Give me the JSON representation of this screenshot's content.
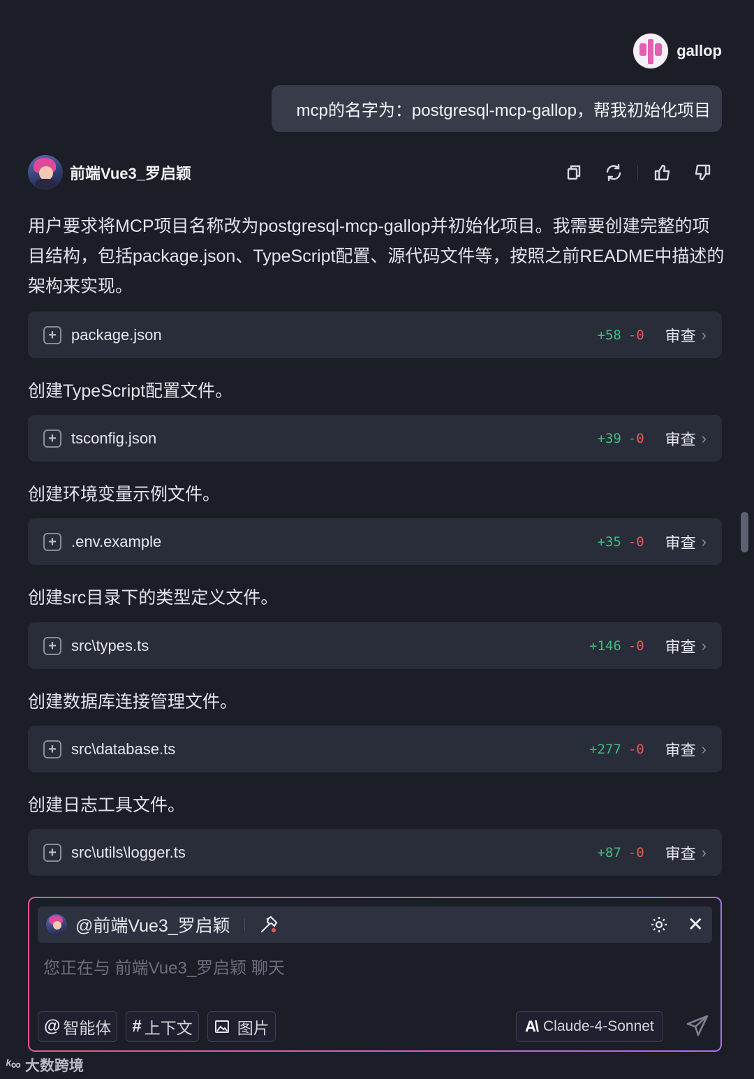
{
  "user": {
    "name": "gallop",
    "message": "mcp的名字为：postgresql-mcp-gallop，帮我初始化项目"
  },
  "assistant": {
    "name": "前端Vue3_罗启颖",
    "intro": "用户要求将MCP项目名称改为postgresql-mcp-gallop并初始化项目。我需要创建完整的项目结构，包括package.json、TypeScript配置、源代码文件等，按照之前README中描述的架构来实现。",
    "actions": [
      "copy-icon",
      "refresh-icon",
      "thumbs-up-icon",
      "thumbs-down-icon"
    ]
  },
  "files": [
    {
      "name": "package.json",
      "added": "+58",
      "removed": "-0",
      "review": "审查"
    },
    {
      "name": "tsconfig.json",
      "added": "+39",
      "removed": "-0",
      "review": "审查"
    },
    {
      "name": ".env.example",
      "added": "+35",
      "removed": "-0",
      "review": "审查"
    },
    {
      "name": "src\\types.ts",
      "added": "+146",
      "removed": "-0",
      "review": "审查"
    },
    {
      "name": "src\\database.ts",
      "added": "+277",
      "removed": "-0",
      "review": "审查"
    },
    {
      "name": "src\\utils\\logger.ts",
      "added": "+87",
      "removed": "-0",
      "review": "审查"
    }
  ],
  "steps": [
    "创建TypeScript配置文件。",
    "创建环境变量示例文件。",
    "创建src目录下的类型定义文件。",
    "创建数据库连接管理文件。",
    "创建日志工具文件。"
  ],
  "composer": {
    "mention": "@前端Vue3_罗启颖",
    "placeholder": "您正在与 前端Vue3_罗启颖 聊天",
    "chips": [
      {
        "symbol": "@",
        "label": "智能体"
      },
      {
        "symbol": "#",
        "label": "上下文"
      },
      {
        "symbol": "image-icon",
        "label": "图片"
      }
    ],
    "model_logo": "A\\",
    "model": "Claude-4-Sonnet"
  },
  "watermark": "大数跨境",
  "colors": {
    "background": "#1b1d27",
    "card": "#292c39",
    "added": "#3fbf7f",
    "removed": "#e25c5c",
    "border_gradient": [
      "#e8578f",
      "#a873e8"
    ]
  }
}
